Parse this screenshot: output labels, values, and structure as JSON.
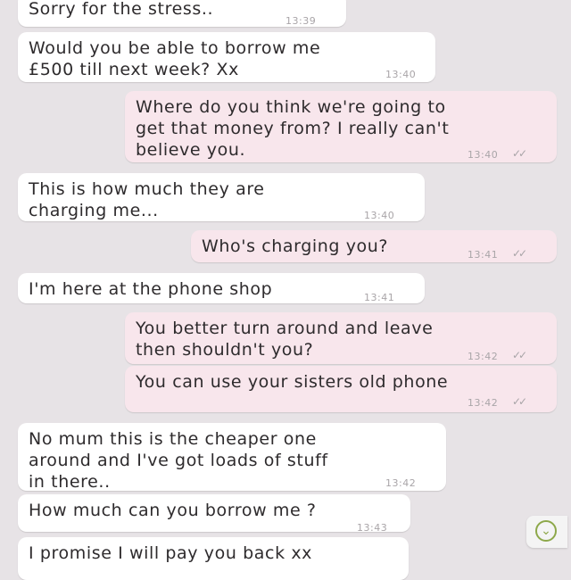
{
  "messages": [
    {
      "lines": [
        "Sorry for the stress.."
      ],
      "time": "13:39",
      "dir": "in"
    },
    {
      "lines": [
        "Would you be able to borrow me",
        "£500 till next week? Xx"
      ],
      "time": "13:40",
      "dir": "in"
    },
    {
      "lines": [
        "Where do you think we're going to",
        "get that money from? I really can't",
        "believe you."
      ],
      "time": "13:40",
      "dir": "out"
    },
    {
      "lines": [
        "This is how much they are",
        "charging me..."
      ],
      "time": "13:40",
      "dir": "in"
    },
    {
      "lines": [
        "Who's charging you?"
      ],
      "time": "13:41",
      "dir": "out"
    },
    {
      "lines": [
        "I'm here at the phone shop"
      ],
      "time": "13:41",
      "dir": "in"
    },
    {
      "lines": [
        "You better turn around and leave",
        "then shouldn't you?"
      ],
      "time": "13:42",
      "dir": "out"
    },
    {
      "lines": [
        "You can use your sisters old phone"
      ],
      "time": "13:42",
      "dir": "out"
    },
    {
      "lines": [
        "No mum this is the cheaper one",
        "around and I've got loads of stuff",
        "in there.."
      ],
      "time": "13:42",
      "dir": "in"
    },
    {
      "lines": [
        "How much can you borrow me ?"
      ],
      "time": "13:43",
      "dir": "in"
    },
    {
      "lines": [
        "I promise I will pay you back xx"
      ],
      "time": "",
      "dir": "in"
    }
  ],
  "read_receipt_icon": "double-check-icon",
  "scroll_down_icon": "chevron-down-icon"
}
